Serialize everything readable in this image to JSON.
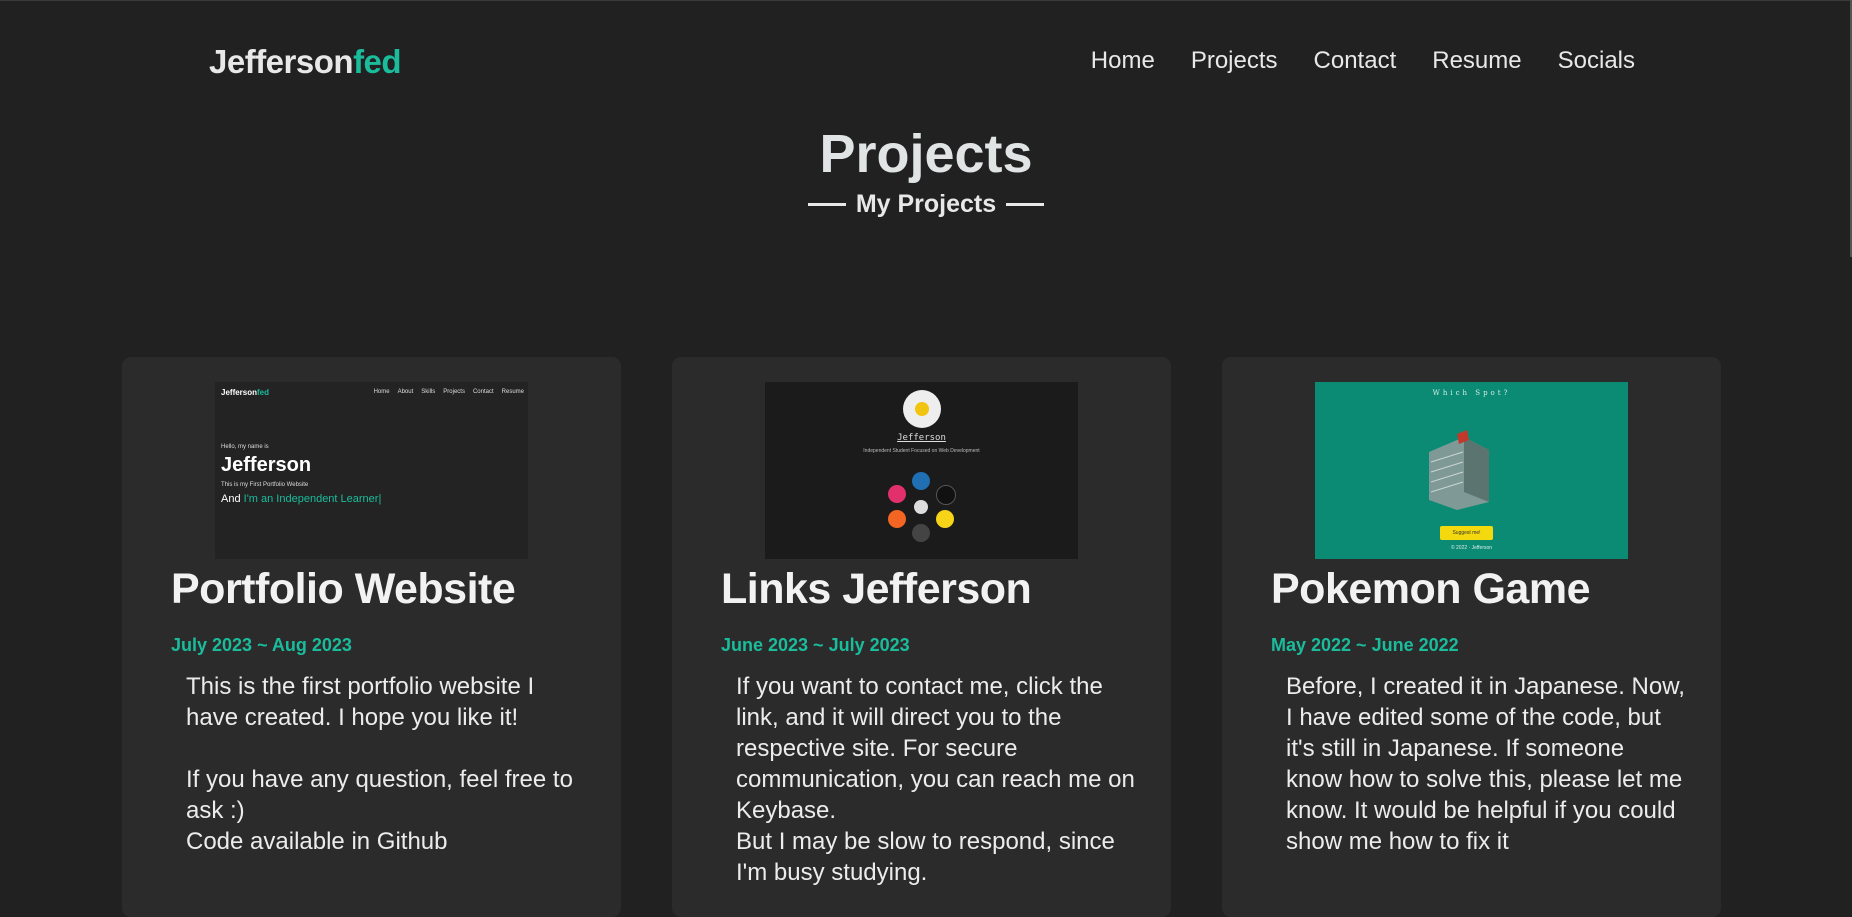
{
  "nav": {
    "logo_main": "Jefferson",
    "logo_accent": "fed",
    "links": [
      "Home",
      "Projects",
      "Contact",
      "Resume",
      "Socials"
    ]
  },
  "header": {
    "title": "Projects",
    "subtitle": "My Projects"
  },
  "projects": [
    {
      "title": "Portfolio Website",
      "date": "July 2023 ~ Aug 2023",
      "description": "This is the first portfolio website I have created. I hope you like it!\n\nIf you have any question, feel free to ask :)\nCode available in Github",
      "thumb": {
        "logo_main": "Jefferson",
        "logo_accent": "fed",
        "nav": [
          "Home",
          "About",
          "Skills",
          "Projects",
          "Contact",
          "Resume"
        ],
        "hello": "Hello, my name is",
        "name": "Jefferson",
        "first": "This is my First Portfolio Website",
        "and": "And",
        "tagline": "I'm an Independent Learner|"
      }
    },
    {
      "title": "Links Jefferson",
      "date": "June 2023 ~ July 2023",
      "description": "If you want to contact me, click the link, and it will direct you to the respective site. For secure communication, you can reach me on Keybase.\nBut I may be slow to respond, since I'm busy studying.",
      "thumb": {
        "name": "Jefferson",
        "tagline": "Independent Student Focused on Web Development"
      }
    },
    {
      "title": "Pokemon Game",
      "date": "May 2022 ~ June 2022",
      "description": "Before, I created it in Japanese. Now, I have edited some of the code, but it's still in Japanese. If someone know how to solve this, please let me know. It would be helpful if you could show me how to fix it",
      "thumb": {
        "title": "Which Spot?",
        "button": "Suggest me!",
        "copy": "© 2022 · Jefferson"
      }
    }
  ],
  "colors": {
    "background": "#212121",
    "card": "#2b2b2b",
    "accent": "#1abc9c",
    "thumb3_bg": "#0b8a74"
  }
}
